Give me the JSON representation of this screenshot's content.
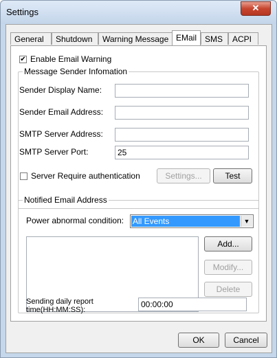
{
  "window": {
    "title": "Settings",
    "close_glyph": "✕"
  },
  "tabs": [
    {
      "label": "General"
    },
    {
      "label": "Shutdown"
    },
    {
      "label": "Warning Message"
    },
    {
      "label": "EMail"
    },
    {
      "label": "SMS"
    },
    {
      "label": "ACPI"
    }
  ],
  "email": {
    "enable_label": "Enable Email Warning",
    "enable_checked": "✔",
    "sender_group": "Message Sender Infomation",
    "display_name_label": "Sender Display Name:",
    "display_name_value": "",
    "email_label": "Sender Email Address:",
    "email_value": "",
    "smtp_server_label": "SMTP Server Address:",
    "smtp_server_value": "",
    "smtp_port_label": "SMTP Server Port:",
    "smtp_port_value": "25",
    "auth_label": "Server Require authentication",
    "settings_button": "Settings...",
    "test_button": "Test",
    "notified_group": "Notified Email Address",
    "power_label": "Power abnormal condition:",
    "power_value": "All Events",
    "add_button": "Add...",
    "modify_button": "Modify...",
    "delete_button": "Delete",
    "daily_report_label_1": "Sending daily report",
    "daily_report_label_2": "time(HH:MM:SS):",
    "daily_report_value": "00:00:00"
  },
  "footer": {
    "ok_button": "OK",
    "cancel_button": "Cancel"
  },
  "icons": {
    "dropdown": "chevron-down-icon",
    "close": "close-icon",
    "check": "check-icon"
  }
}
